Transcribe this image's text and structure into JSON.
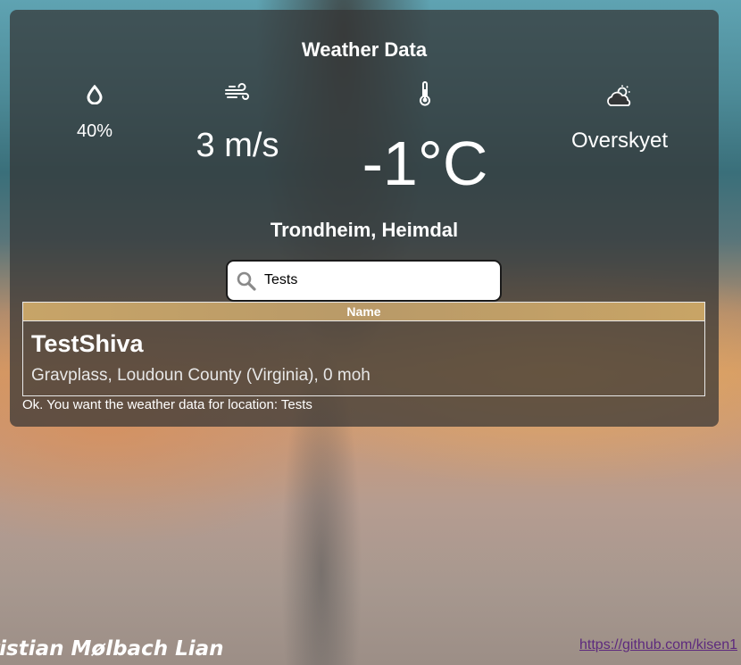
{
  "app": {
    "title": "Weather Data"
  },
  "stats": {
    "humidity": {
      "icon": "droplet-icon",
      "value": "40%"
    },
    "wind": {
      "icon": "wind-icon",
      "value": "3 m/s"
    },
    "temperature": {
      "icon": "thermometer-icon",
      "value": "-1°C"
    },
    "sky": {
      "icon": "cloud-sun-icon",
      "value": "Overskyet"
    }
  },
  "location": "Trondheim, Heimdal",
  "search": {
    "icon": "search-icon",
    "value": "Tests",
    "placeholder": ""
  },
  "results": {
    "header": "Name",
    "items": [
      {
        "name": "TestShiva",
        "description": "Gravplass, Loudoun County (Virginia), 0 moh"
      }
    ]
  },
  "status_text": "Ok. You want the weather data for location: Tests",
  "footer": {
    "author": "Kristian Mølbach Lian",
    "link": "https://github.com/kisen1"
  },
  "colors": {
    "panel_background": "#343434",
    "results_header": "#c2a068",
    "link": "#5d2a7e"
  }
}
